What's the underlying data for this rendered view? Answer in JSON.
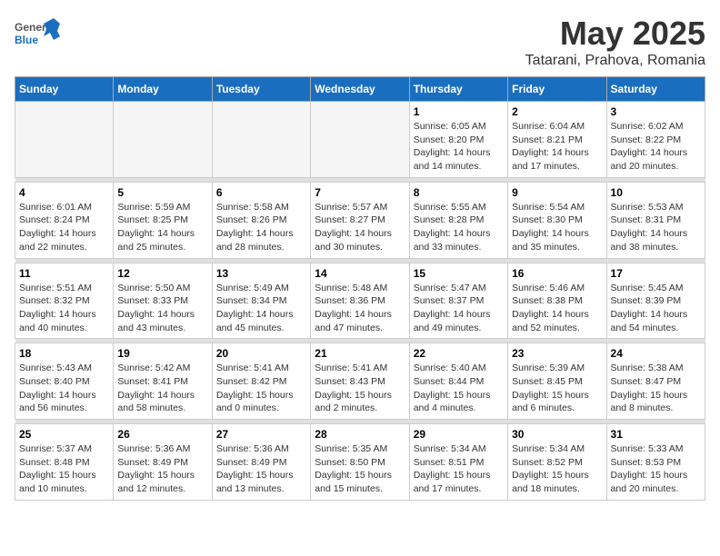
{
  "logo": {
    "general": "General",
    "blue": "Blue"
  },
  "title": "May 2025",
  "subtitle": "Tatarani, Prahova, Romania",
  "weekdays": [
    "Sunday",
    "Monday",
    "Tuesday",
    "Wednesday",
    "Thursday",
    "Friday",
    "Saturday"
  ],
  "weeks": [
    [
      {
        "day": "",
        "empty": true
      },
      {
        "day": "",
        "empty": true
      },
      {
        "day": "",
        "empty": true
      },
      {
        "day": "",
        "empty": true
      },
      {
        "day": "1",
        "sunrise": "6:05 AM",
        "sunset": "8:20 PM",
        "daylight": "14 hours and 14 minutes."
      },
      {
        "day": "2",
        "sunrise": "6:04 AM",
        "sunset": "8:21 PM",
        "daylight": "14 hours and 17 minutes."
      },
      {
        "day": "3",
        "sunrise": "6:02 AM",
        "sunset": "8:22 PM",
        "daylight": "14 hours and 20 minutes."
      }
    ],
    [
      {
        "day": "4",
        "sunrise": "6:01 AM",
        "sunset": "8:24 PM",
        "daylight": "14 hours and 22 minutes."
      },
      {
        "day": "5",
        "sunrise": "5:59 AM",
        "sunset": "8:25 PM",
        "daylight": "14 hours and 25 minutes."
      },
      {
        "day": "6",
        "sunrise": "5:58 AM",
        "sunset": "8:26 PM",
        "daylight": "14 hours and 28 minutes."
      },
      {
        "day": "7",
        "sunrise": "5:57 AM",
        "sunset": "8:27 PM",
        "daylight": "14 hours and 30 minutes."
      },
      {
        "day": "8",
        "sunrise": "5:55 AM",
        "sunset": "8:28 PM",
        "daylight": "14 hours and 33 minutes."
      },
      {
        "day": "9",
        "sunrise": "5:54 AM",
        "sunset": "8:30 PM",
        "daylight": "14 hours and 35 minutes."
      },
      {
        "day": "10",
        "sunrise": "5:53 AM",
        "sunset": "8:31 PM",
        "daylight": "14 hours and 38 minutes."
      }
    ],
    [
      {
        "day": "11",
        "sunrise": "5:51 AM",
        "sunset": "8:32 PM",
        "daylight": "14 hours and 40 minutes."
      },
      {
        "day": "12",
        "sunrise": "5:50 AM",
        "sunset": "8:33 PM",
        "daylight": "14 hours and 43 minutes."
      },
      {
        "day": "13",
        "sunrise": "5:49 AM",
        "sunset": "8:34 PM",
        "daylight": "14 hours and 45 minutes."
      },
      {
        "day": "14",
        "sunrise": "5:48 AM",
        "sunset": "8:36 PM",
        "daylight": "14 hours and 47 minutes."
      },
      {
        "day": "15",
        "sunrise": "5:47 AM",
        "sunset": "8:37 PM",
        "daylight": "14 hours and 49 minutes."
      },
      {
        "day": "16",
        "sunrise": "5:46 AM",
        "sunset": "8:38 PM",
        "daylight": "14 hours and 52 minutes."
      },
      {
        "day": "17",
        "sunrise": "5:45 AM",
        "sunset": "8:39 PM",
        "daylight": "14 hours and 54 minutes."
      }
    ],
    [
      {
        "day": "18",
        "sunrise": "5:43 AM",
        "sunset": "8:40 PM",
        "daylight": "14 hours and 56 minutes."
      },
      {
        "day": "19",
        "sunrise": "5:42 AM",
        "sunset": "8:41 PM",
        "daylight": "14 hours and 58 minutes."
      },
      {
        "day": "20",
        "sunrise": "5:41 AM",
        "sunset": "8:42 PM",
        "daylight": "15 hours and 0 minutes."
      },
      {
        "day": "21",
        "sunrise": "5:41 AM",
        "sunset": "8:43 PM",
        "daylight": "15 hours and 2 minutes."
      },
      {
        "day": "22",
        "sunrise": "5:40 AM",
        "sunset": "8:44 PM",
        "daylight": "15 hours and 4 minutes."
      },
      {
        "day": "23",
        "sunrise": "5:39 AM",
        "sunset": "8:45 PM",
        "daylight": "15 hours and 6 minutes."
      },
      {
        "day": "24",
        "sunrise": "5:38 AM",
        "sunset": "8:47 PM",
        "daylight": "15 hours and 8 minutes."
      }
    ],
    [
      {
        "day": "25",
        "sunrise": "5:37 AM",
        "sunset": "8:48 PM",
        "daylight": "15 hours and 10 minutes."
      },
      {
        "day": "26",
        "sunrise": "5:36 AM",
        "sunset": "8:49 PM",
        "daylight": "15 hours and 12 minutes."
      },
      {
        "day": "27",
        "sunrise": "5:36 AM",
        "sunset": "8:49 PM",
        "daylight": "15 hours and 13 minutes."
      },
      {
        "day": "28",
        "sunrise": "5:35 AM",
        "sunset": "8:50 PM",
        "daylight": "15 hours and 15 minutes."
      },
      {
        "day": "29",
        "sunrise": "5:34 AM",
        "sunset": "8:51 PM",
        "daylight": "15 hours and 17 minutes."
      },
      {
        "day": "30",
        "sunrise": "5:34 AM",
        "sunset": "8:52 PM",
        "daylight": "15 hours and 18 minutes."
      },
      {
        "day": "31",
        "sunrise": "5:33 AM",
        "sunset": "8:53 PM",
        "daylight": "15 hours and 20 minutes."
      }
    ]
  ]
}
